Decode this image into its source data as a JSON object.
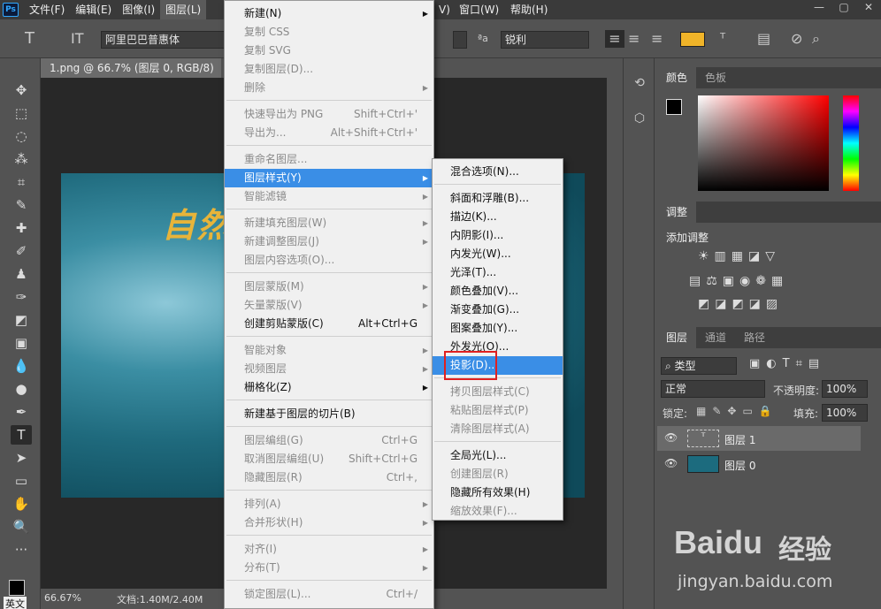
{
  "app_logo": "Ps",
  "menubar": {
    "items": [
      "文件(F)",
      "编辑(E)",
      "图像(I)",
      "图层(L)"
    ],
    "items_right": [
      "V)",
      "窗口(W)",
      "帮助(H)"
    ]
  },
  "window_controls": [
    "—",
    "▢",
    "✕"
  ],
  "options_bar": {
    "font_family": "阿里巴巴普惠体",
    "antialias": "锐利",
    "aa_label": "ªa",
    "accent": "#f0b429"
  },
  "document_tab": "1.png @ 66.7% (图层 0, RGB/8)",
  "document_tab_close": "×",
  "canvas_text": "自然",
  "status": {
    "zoom": "66.67%",
    "doc": "文档:1.40M/2.40M"
  },
  "bottom_left": "英文",
  "panels": {
    "color_tabs": [
      "颜色",
      "色板"
    ],
    "adjust_tab": "调整",
    "adjust_label": "添加调整",
    "layers_tabs": [
      "图层",
      "通道",
      "路径"
    ],
    "kind_filter": "类型",
    "blend_mode": "正常",
    "opacity_label": "不透明度:",
    "opacity": "100%",
    "lock_label": "锁定:",
    "fill_label": "填充:",
    "fill": "100%",
    "layers": [
      {
        "name": "图层 1"
      },
      {
        "name": "图层 0"
      }
    ]
  },
  "layer_menu": [
    {
      "label": "新建(N)",
      "arrow": true
    },
    {
      "label": "复制 CSS",
      "dis": true
    },
    {
      "label": "复制 SVG",
      "dis": true
    },
    {
      "label": "复制图层(D)...",
      "dis": true
    },
    {
      "label": "删除",
      "dis": true,
      "arrow": true
    },
    {
      "sep": true
    },
    {
      "label": "快速导出为 PNG",
      "dis": true,
      "sc": "Shift+Ctrl+'"
    },
    {
      "label": "导出为...",
      "dis": true,
      "sc": "Alt+Shift+Ctrl+'"
    },
    {
      "sep": true
    },
    {
      "label": "重命名图层...",
      "dis": true
    },
    {
      "label": "图层样式(Y)",
      "hi": true,
      "arrow": true
    },
    {
      "label": "智能滤镜",
      "dis": true,
      "arrow": true
    },
    {
      "sep": true
    },
    {
      "label": "新建填充图层(W)",
      "dis": true,
      "arrow": true
    },
    {
      "label": "新建调整图层(J)",
      "dis": true,
      "arrow": true
    },
    {
      "label": "图层内容选项(O)...",
      "dis": true
    },
    {
      "sep": true
    },
    {
      "label": "图层蒙版(M)",
      "dis": true,
      "arrow": true
    },
    {
      "label": "矢量蒙版(V)",
      "dis": true,
      "arrow": true
    },
    {
      "label": "创建剪贴蒙版(C)",
      "sc": "Alt+Ctrl+G"
    },
    {
      "sep": true
    },
    {
      "label": "智能对象",
      "dis": true,
      "arrow": true
    },
    {
      "label": "视频图层",
      "dis": true,
      "arrow": true
    },
    {
      "label": "栅格化(Z)",
      "arrow": true
    },
    {
      "sep": true
    },
    {
      "label": "新建基于图层的切片(B)"
    },
    {
      "sep": true
    },
    {
      "label": "图层编组(G)",
      "dis": true,
      "sc": "Ctrl+G"
    },
    {
      "label": "取消图层编组(U)",
      "dis": true,
      "sc": "Shift+Ctrl+G"
    },
    {
      "label": "隐藏图层(R)",
      "dis": true,
      "sc": "Ctrl+,"
    },
    {
      "sep": true
    },
    {
      "label": "排列(A)",
      "dis": true,
      "arrow": true
    },
    {
      "label": "合并形状(H)",
      "dis": true,
      "arrow": true
    },
    {
      "sep": true
    },
    {
      "label": "对齐(I)",
      "dis": true,
      "arrow": true
    },
    {
      "label": "分布(T)",
      "dis": true,
      "arrow": true
    },
    {
      "sep": true
    },
    {
      "label": "锁定图层(L)...",
      "dis": true,
      "sc": "Ctrl+/"
    }
  ],
  "style_submenu": [
    {
      "label": "混合选项(N)..."
    },
    {
      "sep": true
    },
    {
      "label": "斜面和浮雕(B)..."
    },
    {
      "label": "描边(K)..."
    },
    {
      "label": "内阴影(I)..."
    },
    {
      "label": "内发光(W)..."
    },
    {
      "label": "光泽(T)..."
    },
    {
      "label": "颜色叠加(V)..."
    },
    {
      "label": "渐变叠加(G)..."
    },
    {
      "label": "图案叠加(Y)..."
    },
    {
      "label": "外发光(O)..."
    },
    {
      "label": "投影(D)...",
      "hi": true
    },
    {
      "sep": true
    },
    {
      "label": "拷贝图层样式(C)",
      "dis": true
    },
    {
      "label": "粘贴图层样式(P)",
      "dis": true
    },
    {
      "label": "清除图层样式(A)",
      "dis": true
    },
    {
      "sep": true
    },
    {
      "label": "全局光(L)..."
    },
    {
      "label": "创建图层(R)",
      "dis": true
    },
    {
      "label": "隐藏所有效果(H)"
    },
    {
      "label": "缩放效果(F)...",
      "dis": true
    }
  ],
  "watermark": {
    "brand": "Bai",
    "brand2": "du",
    "cn": "经验",
    "url": "jingyan.baidu.com"
  }
}
